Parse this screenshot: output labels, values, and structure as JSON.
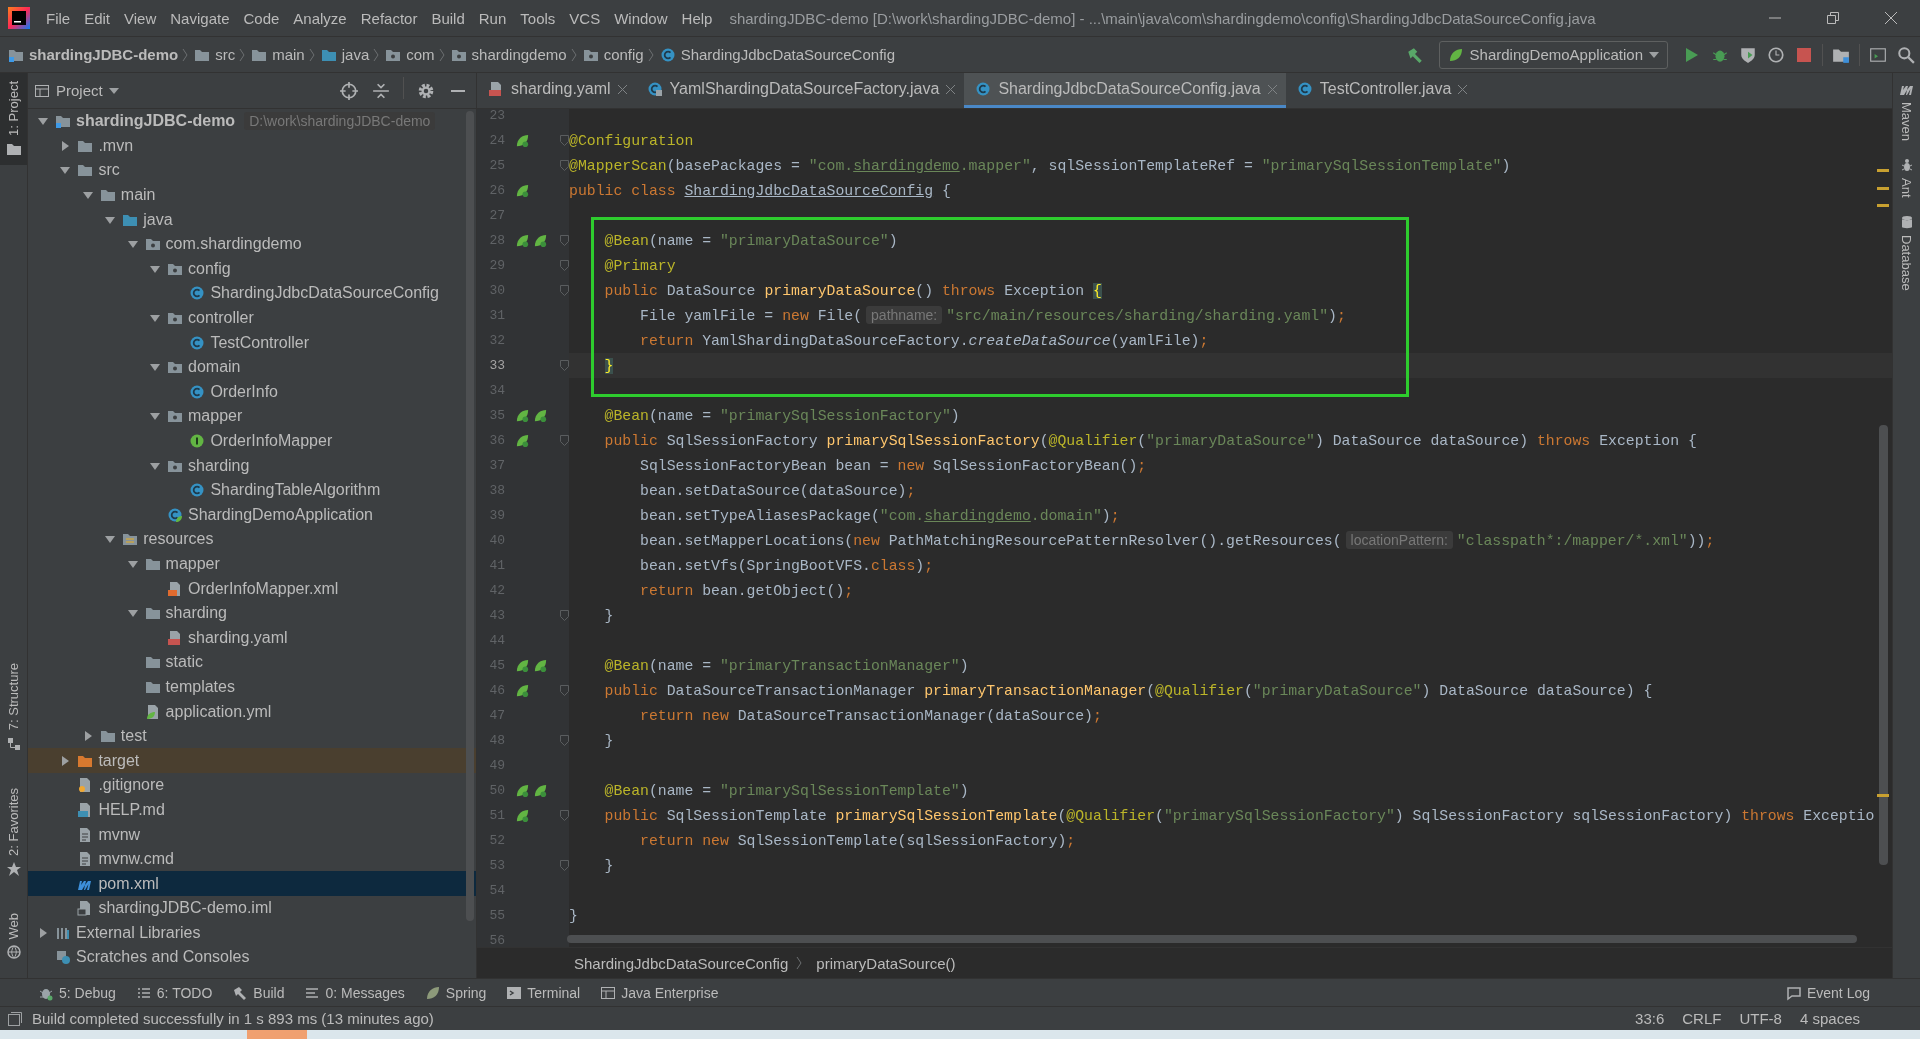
{
  "menu": [
    "File",
    "Edit",
    "View",
    "Navigate",
    "Code",
    "Analyze",
    "Refactor",
    "Build",
    "Run",
    "Tools",
    "VCS",
    "Window",
    "Help"
  ],
  "window": {
    "title": "shardingJDBC-demo [D:\\work\\shardingJDBC-demo] - ...\\main\\java\\com\\shardingdemo\\config\\ShardingJdbcDataSourceConfig.java"
  },
  "navbar": {
    "breadcrumbs": [
      {
        "label": "shardingJDBC-demo",
        "kind": "module"
      },
      {
        "label": "src",
        "kind": "folder"
      },
      {
        "label": "main",
        "kind": "folder"
      },
      {
        "label": "java",
        "kind": "source-folder"
      },
      {
        "label": "com",
        "kind": "package"
      },
      {
        "label": "shardingdemo",
        "kind": "package"
      },
      {
        "label": "config",
        "kind": "package"
      },
      {
        "label": "ShardingJdbcDataSourceConfig",
        "kind": "class"
      }
    ],
    "run_config": "ShardingDemoApplication"
  },
  "left_strip": [
    {
      "label": "1: Project",
      "kind": "project",
      "selected": true
    },
    {
      "label": "7: Structure",
      "kind": "structure",
      "selected": false
    },
    {
      "label": "2: Favorites",
      "kind": "favorites",
      "selected": false
    },
    {
      "label": "Web",
      "kind": "web",
      "selected": false
    }
  ],
  "right_strip": [
    {
      "label": "Maven",
      "kind": "maven"
    },
    {
      "label": "Ant",
      "kind": "ant"
    },
    {
      "label": "Database",
      "kind": "database"
    }
  ],
  "project": {
    "title": "Project",
    "tree": [
      {
        "label": "shardingJDBC-demo",
        "kind": "module",
        "hint": "D:\\work\\shardingJDBC-demo",
        "expanded": true,
        "selected": false,
        "children": [
          {
            "label": ".mvn",
            "kind": "folder",
            "expanded": false,
            "selected": false
          },
          {
            "label": "src",
            "kind": "folder",
            "expanded": true,
            "selected": false,
            "children": [
              {
                "label": "main",
                "kind": "folder",
                "expanded": true,
                "selected": false,
                "children": [
                  {
                    "label": "java",
                    "kind": "source-folder",
                    "expanded": true,
                    "selected": false,
                    "children": [
                      {
                        "label": "com.shardingdemo",
                        "kind": "package",
                        "expanded": true,
                        "selected": false,
                        "children": [
                          {
                            "label": "config",
                            "kind": "package",
                            "expanded": true,
                            "selected": false,
                            "children": [
                              {
                                "label": "ShardingJdbcDataSourceConfig",
                                "kind": "class",
                                "selected": false
                              }
                            ]
                          },
                          {
                            "label": "controller",
                            "kind": "package",
                            "expanded": true,
                            "selected": false,
                            "children": [
                              {
                                "label": "TestController",
                                "kind": "class",
                                "selected": false
                              }
                            ]
                          },
                          {
                            "label": "domain",
                            "kind": "package",
                            "expanded": true,
                            "selected": false,
                            "children": [
                              {
                                "label": "OrderInfo",
                                "kind": "class",
                                "selected": false
                              }
                            ]
                          },
                          {
                            "label": "mapper",
                            "kind": "package",
                            "expanded": true,
                            "selected": false,
                            "children": [
                              {
                                "label": "OrderInfoMapper",
                                "kind": "interface",
                                "selected": false
                              }
                            ]
                          },
                          {
                            "label": "sharding",
                            "kind": "package",
                            "expanded": true,
                            "selected": false,
                            "children": [
                              {
                                "label": "ShardingTableAlgorithm",
                                "kind": "class",
                                "selected": false
                              }
                            ]
                          },
                          {
                            "label": "ShardingDemoApplication",
                            "kind": "spring-class",
                            "selected": false
                          }
                        ]
                      }
                    ]
                  },
                  {
                    "label": "resources",
                    "kind": "resource-folder",
                    "expanded": true,
                    "selected": false,
                    "children": [
                      {
                        "label": "mapper",
                        "kind": "folder",
                        "expanded": true,
                        "selected": false,
                        "children": [
                          {
                            "label": "OrderInfoMapper.xml",
                            "kind": "xml",
                            "selected": false
                          }
                        ]
                      },
                      {
                        "label": "sharding",
                        "kind": "folder",
                        "expanded": true,
                        "selected": false,
                        "children": [
                          {
                            "label": "sharding.yaml",
                            "kind": "yaml",
                            "selected": false
                          }
                        ]
                      },
                      {
                        "label": "static",
                        "kind": "folder",
                        "selected": false
                      },
                      {
                        "label": "templates",
                        "kind": "folder",
                        "selected": false
                      },
                      {
                        "label": "application.yml",
                        "kind": "yml",
                        "selected": false
                      }
                    ]
                  }
                ]
              },
              {
                "label": "test",
                "kind": "folder",
                "expanded": false,
                "selected": false
              }
            ]
          },
          {
            "label": "target",
            "kind": "excluded-folder",
            "expanded": false,
            "selected": false
          },
          {
            "label": ".gitignore",
            "kind": "gitignore",
            "selected": false
          },
          {
            "label": "HELP.md",
            "kind": "md",
            "selected": false
          },
          {
            "label": "mvnw",
            "kind": "script",
            "selected": false
          },
          {
            "label": "mvnw.cmd",
            "kind": "script",
            "selected": false
          },
          {
            "label": "pom.xml",
            "kind": "maven",
            "selected": true
          },
          {
            "label": "shardingJDBC-demo.iml",
            "kind": "iml",
            "selected": false
          }
        ]
      },
      {
        "label": "External Libraries",
        "kind": "libraries",
        "expanded": false,
        "selected": false
      },
      {
        "label": "Scratches and Consoles",
        "kind": "scratches",
        "selected": false
      }
    ]
  },
  "editor": {
    "tabs": [
      {
        "label": "sharding.yaml",
        "kind": "yaml",
        "selected": false
      },
      {
        "label": "YamlShardingDataSourceFactory.java",
        "kind": "lib-class",
        "selected": false
      },
      {
        "label": "ShardingJdbcDataSourceConfig.java",
        "kind": "class",
        "selected": true
      },
      {
        "label": "TestController.java",
        "kind": "class",
        "selected": false
      }
    ],
    "blocks": [
      {
        "boxed": false,
        "lines": [
          {
            "n": "23"
          },
          {
            "n": "24",
            "gutter": {
              "kind": "bean"
            },
            "fold": true,
            "code": [
              {
                "kind": "annotation",
                "text": "@Configuration"
              }
            ]
          },
          {
            "n": "25",
            "fold": true,
            "code": [
              {
                "kind": "annotation",
                "text": "@MapperScan"
              },
              {
                "kind": "plain",
                "text": "(basePackages = "
              },
              {
                "kind": "string",
                "text": "\"com."
              },
              {
                "kind": "string-underline",
                "text": "shardingdemo"
              },
              {
                "kind": "string",
                "text": ".mapper\""
              },
              {
                "kind": "plain",
                "text": ", sqlSessionTemplateRef = "
              },
              {
                "kind": "string",
                "text": "\"primarySqlSessionTemplate\""
              },
              {
                "kind": "plain",
                "text": ")"
              }
            ]
          },
          {
            "n": "26",
            "gutter": {
              "kind": "bean"
            },
            "code": [
              {
                "kind": "keyword",
                "text": "public class "
              },
              {
                "kind": "underline",
                "text": "ShardingJdbcDataSourceConfig"
              },
              {
                "kind": "plain",
                "text": " {"
              }
            ]
          },
          {
            "n": "27"
          }
        ]
      },
      {
        "boxed": true,
        "lines": [
          {
            "n": "28",
            "gutter": {
              "kind": "bean-pair"
            },
            "fold": true,
            "code": [
              {
                "kind": "annotation",
                "text": "    @Bean"
              },
              {
                "kind": "plain",
                "text": "(name = "
              },
              {
                "kind": "string",
                "text": "\"primaryDataSource\""
              },
              {
                "kind": "plain",
                "text": ")"
              }
            ]
          },
          {
            "n": "29",
            "fold": true,
            "code": [
              {
                "kind": "annotation",
                "text": "    @Primary"
              }
            ]
          },
          {
            "n": "30",
            "fold": true,
            "code": [
              {
                "kind": "keyword",
                "text": "    public "
              },
              {
                "kind": "plain",
                "text": "DataSource "
              },
              {
                "kind": "method",
                "text": "primaryDataSource"
              },
              {
                "kind": "plain",
                "text": "() "
              },
              {
                "kind": "keyword",
                "text": "throws "
              },
              {
                "kind": "plain",
                "text": "Exception "
              },
              {
                "kind": "brace",
                "text": "{"
              }
            ]
          },
          {
            "n": "31",
            "code": [
              {
                "kind": "plain",
                "text": "        File yamlFile = "
              },
              {
                "kind": "keyword",
                "text": "new "
              },
              {
                "kind": "plain",
                "text": "File("
              },
              {
                "kind": "hint",
                "text": "pathname:"
              },
              {
                "kind": "string",
                "text": "\"src/main/resources/sharding/sharding.yaml\""
              },
              {
                "kind": "plain",
                "text": ")"
              },
              {
                "kind": "keyword",
                "text": ";"
              }
            ]
          },
          {
            "n": "32",
            "code": [
              {
                "kind": "keyword",
                "text": "        return "
              },
              {
                "kind": "plain",
                "text": "YamlShardingDataSourceFactory."
              },
              {
                "kind": "italic",
                "text": "createDataSource"
              },
              {
                "kind": "plain",
                "text": "(yamlFile)"
              },
              {
                "kind": "keyword",
                "text": ";"
              }
            ]
          },
          {
            "n": "33",
            "current": true,
            "fold": true,
            "code": [
              {
                "kind": "brace",
                "text": "    }"
              }
            ]
          }
        ]
      },
      {
        "boxed": false,
        "lines": [
          {
            "n": "34"
          },
          {
            "n": "35",
            "gutter": {
              "kind": "bean-pair"
            },
            "code": [
              {
                "kind": "annotation",
                "text": "    @Bean"
              },
              {
                "kind": "plain",
                "text": "(name = "
              },
              {
                "kind": "string",
                "text": "\"primarySqlSessionFactory\""
              },
              {
                "kind": "plain",
                "text": ")"
              }
            ]
          },
          {
            "n": "36",
            "gutter": {
              "kind": "bean"
            },
            "fold": true,
            "code": [
              {
                "kind": "keyword",
                "text": "    public "
              },
              {
                "kind": "plain",
                "text": "SqlSessionFactory "
              },
              {
                "kind": "method",
                "text": "primarySqlSessionFactory"
              },
              {
                "kind": "plain",
                "text": "("
              },
              {
                "kind": "annotation",
                "text": "@Qualifier"
              },
              {
                "kind": "plain",
                "text": "("
              },
              {
                "kind": "string",
                "text": "\"primaryDataSource\""
              },
              {
                "kind": "plain",
                "text": ") DataSource dataSource) "
              },
              {
                "kind": "keyword",
                "text": "throws "
              },
              {
                "kind": "plain",
                "text": "Exception {"
              }
            ]
          },
          {
            "n": "37",
            "code": [
              {
                "kind": "plain",
                "text": "        SqlSessionFactoryBean bean = "
              },
              {
                "kind": "keyword",
                "text": "new "
              },
              {
                "kind": "plain",
                "text": "SqlSessionFactoryBean()"
              },
              {
                "kind": "keyword",
                "text": ";"
              }
            ]
          },
          {
            "n": "38",
            "code": [
              {
                "kind": "plain",
                "text": "        bean.setDataSource(dataSource)"
              },
              {
                "kind": "keyword",
                "text": ";"
              }
            ]
          },
          {
            "n": "39",
            "code": [
              {
                "kind": "plain",
                "text": "        bean.setTypeAliasesPackage("
              },
              {
                "kind": "string",
                "text": "\"com."
              },
              {
                "kind": "string-underline",
                "text": "shardingdemo"
              },
              {
                "kind": "string",
                "text": ".domain\""
              },
              {
                "kind": "plain",
                "text": ")"
              },
              {
                "kind": "keyword",
                "text": ";"
              }
            ]
          },
          {
            "n": "40",
            "code": [
              {
                "kind": "plain",
                "text": "        bean.setMapperLocations("
              },
              {
                "kind": "keyword",
                "text": "new "
              },
              {
                "kind": "plain",
                "text": "PathMatchingResourcePatternResolver().getResources("
              },
              {
                "kind": "hint",
                "text": "locationPattern:"
              },
              {
                "kind": "string",
                "text": "\"classpath*:/mapper/*.xml\""
              },
              {
                "kind": "plain",
                "text": "))"
              },
              {
                "kind": "keyword",
                "text": ";"
              }
            ]
          },
          {
            "n": "41",
            "code": [
              {
                "kind": "plain",
                "text": "        bean.setVfs(SpringBootVFS."
              },
              {
                "kind": "keyword",
                "text": "class"
              },
              {
                "kind": "plain",
                "text": ")"
              },
              {
                "kind": "keyword",
                "text": ";"
              }
            ]
          },
          {
            "n": "42",
            "code": [
              {
                "kind": "keyword",
                "text": "        return "
              },
              {
                "kind": "plain",
                "text": "bean.getObject()"
              },
              {
                "kind": "keyword",
                "text": ";"
              }
            ]
          },
          {
            "n": "43",
            "fold": true,
            "code": [
              {
                "kind": "plain",
                "text": "    }"
              }
            ]
          },
          {
            "n": "44"
          },
          {
            "n": "45",
            "gutter": {
              "kind": "bean-pair"
            },
            "code": [
              {
                "kind": "annotation",
                "text": "    @Bean"
              },
              {
                "kind": "plain",
                "text": "(name = "
              },
              {
                "kind": "string",
                "text": "\"primaryTransactionManager\""
              },
              {
                "kind": "plain",
                "text": ")"
              }
            ]
          },
          {
            "n": "46",
            "gutter": {
              "kind": "bean"
            },
            "fold": true,
            "code": [
              {
                "kind": "keyword",
                "text": "    public "
              },
              {
                "kind": "plain",
                "text": "DataSourceTransactionManager "
              },
              {
                "kind": "method",
                "text": "primaryTransactionManager"
              },
              {
                "kind": "plain",
                "text": "("
              },
              {
                "kind": "annotation",
                "text": "@Qualifier"
              },
              {
                "kind": "plain",
                "text": "("
              },
              {
                "kind": "string",
                "text": "\"primaryDataSource\""
              },
              {
                "kind": "plain",
                "text": ") DataSource dataSource) {"
              }
            ]
          },
          {
            "n": "47",
            "code": [
              {
                "kind": "keyword",
                "text": "        return new "
              },
              {
                "kind": "plain",
                "text": "DataSourceTransactionManager(dataSource)"
              },
              {
                "kind": "keyword",
                "text": ";"
              }
            ]
          },
          {
            "n": "48",
            "fold": true,
            "code": [
              {
                "kind": "plain",
                "text": "    }"
              }
            ]
          },
          {
            "n": "49"
          },
          {
            "n": "50",
            "gutter": {
              "kind": "bean-pair"
            },
            "code": [
              {
                "kind": "annotation",
                "text": "    @Bean"
              },
              {
                "kind": "plain",
                "text": "(name = "
              },
              {
                "kind": "string",
                "text": "\"primarySqlSessionTemplate\""
              },
              {
                "kind": "plain",
                "text": ")"
              }
            ]
          },
          {
            "n": "51",
            "gutter": {
              "kind": "bean"
            },
            "fold": true,
            "code": [
              {
                "kind": "keyword",
                "text": "    public "
              },
              {
                "kind": "plain",
                "text": "SqlSessionTemplate "
              },
              {
                "kind": "method",
                "text": "primarySqlSessionTemplate"
              },
              {
                "kind": "plain",
                "text": "("
              },
              {
                "kind": "annotation",
                "text": "@Qualifier"
              },
              {
                "kind": "plain",
                "text": "("
              },
              {
                "kind": "string",
                "text": "\"primarySqlSessionFactory\""
              },
              {
                "kind": "plain",
                "text": ") SqlSessionFactory sqlSessionFactory) "
              },
              {
                "kind": "keyword",
                "text": "throws "
              },
              {
                "kind": "plain",
                "text": "Exceptio"
              }
            ]
          },
          {
            "n": "52",
            "code": [
              {
                "kind": "keyword",
                "text": "        return new "
              },
              {
                "kind": "plain",
                "text": "SqlSessionTemplate(sqlSessionFactory)"
              },
              {
                "kind": "keyword",
                "text": ";"
              }
            ]
          },
          {
            "n": "53",
            "fold": true,
            "code": [
              {
                "kind": "plain",
                "text": "    }"
              }
            ]
          },
          {
            "n": "54"
          },
          {
            "n": "55",
            "code": [
              {
                "kind": "plain",
                "text": "}"
              }
            ]
          },
          {
            "n": "56"
          }
        ]
      }
    ],
    "breadcrumbs": [
      "ShardingJdbcDataSourceConfig",
      "primaryDataSource()"
    ]
  },
  "tool_windows": [
    {
      "label": "5: Debug",
      "kind": "debug"
    },
    {
      "label": "6: TODO",
      "kind": "todo"
    },
    {
      "label": "Build",
      "kind": "build"
    },
    {
      "label": "0: Messages",
      "kind": "messages"
    },
    {
      "label": "Spring",
      "kind": "spring"
    },
    {
      "label": "Terminal",
      "kind": "terminal"
    },
    {
      "label": "Java Enterprise",
      "kind": "javaee"
    }
  ],
  "event_log": "Event Log",
  "status_bar": {
    "message": "Build completed successfully in 1 s 893 ms (13 minutes ago)",
    "position": "33:6",
    "line_separator": "CRLF",
    "encoding": "UTF-8",
    "indent": "4 spaces"
  }
}
